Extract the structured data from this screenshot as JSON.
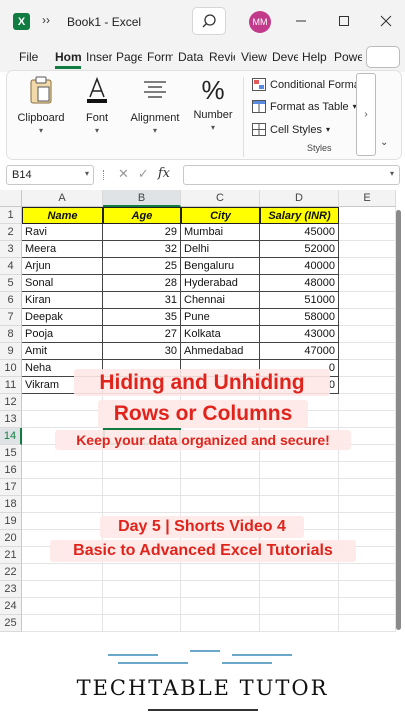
{
  "titlebar": {
    "app_icon": "X",
    "title": "Book1  -  Excel",
    "avatar_initials": "MM"
  },
  "tabs": [
    {
      "label": "File"
    },
    {
      "label": "Home"
    },
    {
      "label": "Insert"
    },
    {
      "label": "Page"
    },
    {
      "label": "Formulas"
    },
    {
      "label": "Data"
    },
    {
      "label": "Review"
    },
    {
      "label": "View"
    },
    {
      "label": "Developer"
    },
    {
      "label": "Help"
    },
    {
      "label": "Power"
    }
  ],
  "ribbon": {
    "clipboard": "Clipboard",
    "font": "Font",
    "alignment": "Alignment",
    "number": "Number",
    "number_symbol": "%",
    "conditional": "Conditional Forma",
    "format_table": "Format as Table",
    "cell_styles": "Cell Styles",
    "styles_group": "Styles"
  },
  "formula_bar": {
    "name_box": "B14",
    "fx": "fx",
    "value": ""
  },
  "sheet": {
    "columns": [
      "A",
      "B",
      "C",
      "D",
      "E"
    ],
    "rows": [
      "1",
      "2",
      "3",
      "4",
      "5",
      "6",
      "7",
      "8",
      "9",
      "10",
      "11",
      "12",
      "13",
      "14",
      "15",
      "16",
      "17",
      "18",
      "19",
      "20",
      "21",
      "22",
      "23",
      "24",
      "25"
    ],
    "selected_cell": "B14",
    "headers": [
      "Name",
      "Age",
      "City",
      "Salary (INR)"
    ],
    "data": [
      [
        "Ravi",
        "29",
        "Mumbai",
        "45000"
      ],
      [
        "Meera",
        "32",
        "Delhi",
        "52000"
      ],
      [
        "Arjun",
        "25",
        "Bengaluru",
        "40000"
      ],
      [
        "Sonal",
        "28",
        "Hyderabad",
        "48000"
      ],
      [
        "Kiran",
        "31",
        "Chennai",
        "51000"
      ],
      [
        "Deepak",
        "35",
        "Pune",
        "58000"
      ],
      [
        "Pooja",
        "27",
        "Kolkata",
        "43000"
      ],
      [
        "Amit",
        "30",
        "Ahmedabad",
        "47000"
      ],
      [
        "Neha",
        "",
        "",
        "0"
      ],
      [
        "Vikram",
        "",
        "",
        "0"
      ]
    ]
  },
  "overlay": {
    "title_line1": "Hiding and Unhiding",
    "title_line2": "Rows or Columns",
    "subtitle": "Keep your data organized and secure!",
    "series_line1": "Day 5 | Shorts Video 4",
    "series_line2": "Basic to Advanced Excel Tutorials"
  },
  "footer": {
    "brand": "TECHTABLE TUTOR"
  },
  "colors": {
    "excel_green": "#107c41",
    "header_fill": "#ffff00",
    "overlay_text": "#e0241b",
    "avatar": "#c23a8a"
  }
}
